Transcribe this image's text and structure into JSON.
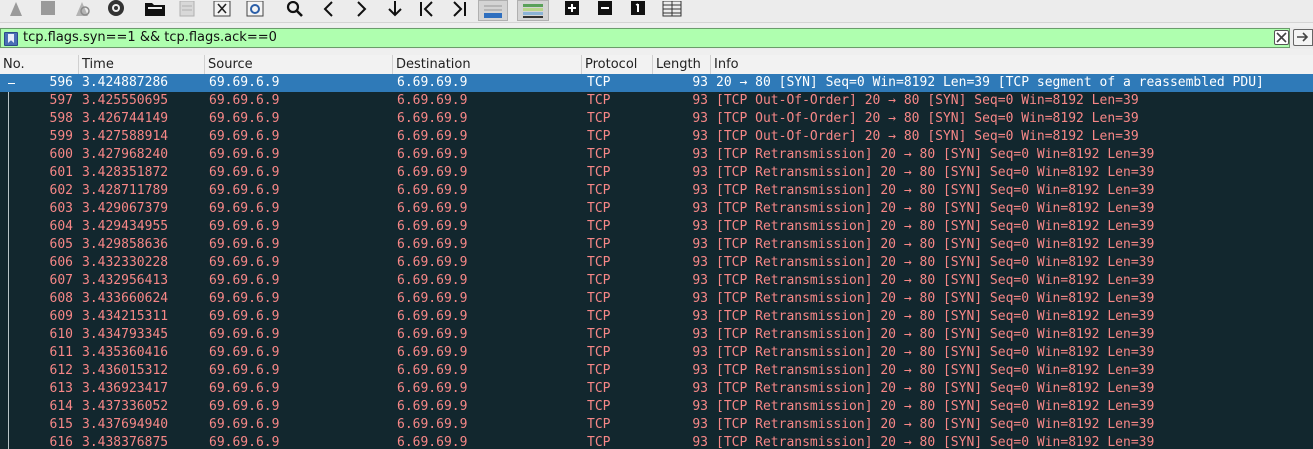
{
  "filter": {
    "value": "tcp.flags.syn==1 && tcp.flags.ack==0"
  },
  "toolbar": {
    "icons": [
      "start-capture-icon",
      "stop-capture-icon",
      "restart-capture-icon",
      "capture-options-icon",
      "open-file-icon",
      "save-file-icon",
      "close-file-icon",
      "reload-file-icon",
      "find-packet-icon",
      "go-back-icon",
      "go-forward-icon",
      "go-to-packet-icon",
      "first-packet-icon",
      "last-packet-icon",
      "auto-scroll-icon",
      "colorize-icon",
      "zoom-in-icon",
      "zoom-out-icon",
      "normal-size-icon",
      "resize-columns-icon"
    ]
  },
  "columns": [
    "No.",
    "Time",
    "Source",
    "Destination",
    "Protocol",
    "Length",
    "Info"
  ],
  "packets": [
    {
      "no": "596",
      "time": "3.424887286",
      "src": "69.69.6.9",
      "dst": "6.69.69.9",
      "proto": "TCP",
      "len": "93",
      "info": "20 → 80 [SYN] Seq=0 Win=8192 Len=39 [TCP segment of a reassembled PDU]"
    },
    {
      "no": "597",
      "time": "3.425550695",
      "src": "69.69.6.9",
      "dst": "6.69.69.9",
      "proto": "TCP",
      "len": "93",
      "info": "[TCP Out-Of-Order] 20 → 80 [SYN] Seq=0 Win=8192 Len=39"
    },
    {
      "no": "598",
      "time": "3.426744149",
      "src": "69.69.6.9",
      "dst": "6.69.69.9",
      "proto": "TCP",
      "len": "93",
      "info": "[TCP Out-Of-Order] 20 → 80 [SYN] Seq=0 Win=8192 Len=39"
    },
    {
      "no": "599",
      "time": "3.427588914",
      "src": "69.69.6.9",
      "dst": "6.69.69.9",
      "proto": "TCP",
      "len": "93",
      "info": "[TCP Out-Of-Order] 20 → 80 [SYN] Seq=0 Win=8192 Len=39"
    },
    {
      "no": "600",
      "time": "3.427968240",
      "src": "69.69.6.9",
      "dst": "6.69.69.9",
      "proto": "TCP",
      "len": "93",
      "info": "[TCP Retransmission] 20 → 80 [SYN] Seq=0 Win=8192 Len=39"
    },
    {
      "no": "601",
      "time": "3.428351872",
      "src": "69.69.6.9",
      "dst": "6.69.69.9",
      "proto": "TCP",
      "len": "93",
      "info": "[TCP Retransmission] 20 → 80 [SYN] Seq=0 Win=8192 Len=39"
    },
    {
      "no": "602",
      "time": "3.428711789",
      "src": "69.69.6.9",
      "dst": "6.69.69.9",
      "proto": "TCP",
      "len": "93",
      "info": "[TCP Retransmission] 20 → 80 [SYN] Seq=0 Win=8192 Len=39"
    },
    {
      "no": "603",
      "time": "3.429067379",
      "src": "69.69.6.9",
      "dst": "6.69.69.9",
      "proto": "TCP",
      "len": "93",
      "info": "[TCP Retransmission] 20 → 80 [SYN] Seq=0 Win=8192 Len=39"
    },
    {
      "no": "604",
      "time": "3.429434955",
      "src": "69.69.6.9",
      "dst": "6.69.69.9",
      "proto": "TCP",
      "len": "93",
      "info": "[TCP Retransmission] 20 → 80 [SYN] Seq=0 Win=8192 Len=39"
    },
    {
      "no": "605",
      "time": "3.429858636",
      "src": "69.69.6.9",
      "dst": "6.69.69.9",
      "proto": "TCP",
      "len": "93",
      "info": "[TCP Retransmission] 20 → 80 [SYN] Seq=0 Win=8192 Len=39"
    },
    {
      "no": "606",
      "time": "3.432330228",
      "src": "69.69.6.9",
      "dst": "6.69.69.9",
      "proto": "TCP",
      "len": "93",
      "info": "[TCP Retransmission] 20 → 80 [SYN] Seq=0 Win=8192 Len=39"
    },
    {
      "no": "607",
      "time": "3.432956413",
      "src": "69.69.6.9",
      "dst": "6.69.69.9",
      "proto": "TCP",
      "len": "93",
      "info": "[TCP Retransmission] 20 → 80 [SYN] Seq=0 Win=8192 Len=39"
    },
    {
      "no": "608",
      "time": "3.433660624",
      "src": "69.69.6.9",
      "dst": "6.69.69.9",
      "proto": "TCP",
      "len": "93",
      "info": "[TCP Retransmission] 20 → 80 [SYN] Seq=0 Win=8192 Len=39"
    },
    {
      "no": "609",
      "time": "3.434215311",
      "src": "69.69.6.9",
      "dst": "6.69.69.9",
      "proto": "TCP",
      "len": "93",
      "info": "[TCP Retransmission] 20 → 80 [SYN] Seq=0 Win=8192 Len=39"
    },
    {
      "no": "610",
      "time": "3.434793345",
      "src": "69.69.6.9",
      "dst": "6.69.69.9",
      "proto": "TCP",
      "len": "93",
      "info": "[TCP Retransmission] 20 → 80 [SYN] Seq=0 Win=8192 Len=39"
    },
    {
      "no": "611",
      "time": "3.435360416",
      "src": "69.69.6.9",
      "dst": "6.69.69.9",
      "proto": "TCP",
      "len": "93",
      "info": "[TCP Retransmission] 20 → 80 [SYN] Seq=0 Win=8192 Len=39"
    },
    {
      "no": "612",
      "time": "3.436015312",
      "src": "69.69.6.9",
      "dst": "6.69.69.9",
      "proto": "TCP",
      "len": "93",
      "info": "[TCP Retransmission] 20 → 80 [SYN] Seq=0 Win=8192 Len=39"
    },
    {
      "no": "613",
      "time": "3.436923417",
      "src": "69.69.6.9",
      "dst": "6.69.69.9",
      "proto": "TCP",
      "len": "93",
      "info": "[TCP Retransmission] 20 → 80 [SYN] Seq=0 Win=8192 Len=39"
    },
    {
      "no": "614",
      "time": "3.437336052",
      "src": "69.69.6.9",
      "dst": "6.69.69.9",
      "proto": "TCP",
      "len": "93",
      "info": "[TCP Retransmission] 20 → 80 [SYN] Seq=0 Win=8192 Len=39"
    },
    {
      "no": "615",
      "time": "3.437694940",
      "src": "69.69.6.9",
      "dst": "6.69.69.9",
      "proto": "TCP",
      "len": "93",
      "info": "[TCP Retransmission] 20 → 80 [SYN] Seq=0 Win=8192 Len=39"
    },
    {
      "no": "616",
      "time": "3.438376875",
      "src": "69.69.6.9",
      "dst": "6.69.69.9",
      "proto": "TCP",
      "len": "93",
      "info": "[TCP Retransmission] 20 → 80 [SYN] Seq=0 Win=8192 Len=39"
    }
  ],
  "colors": {
    "selected_row": "#2f7ab8",
    "list_bg": "#12272e",
    "row_text": "#f78787",
    "filter_valid": "#afffaf"
  }
}
